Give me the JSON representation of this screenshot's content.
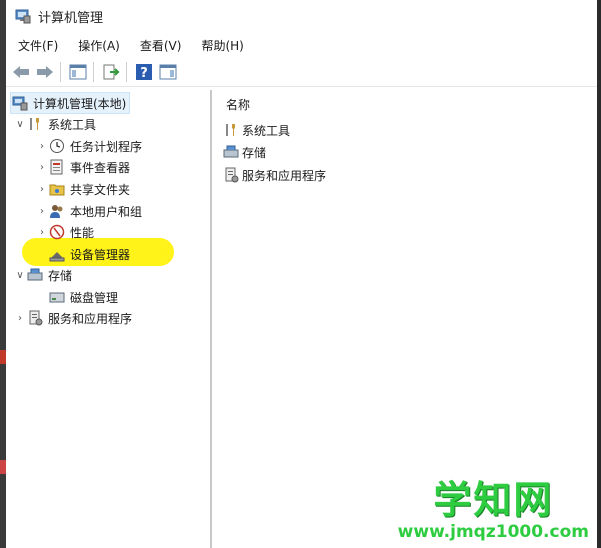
{
  "window": {
    "title": "计算机管理"
  },
  "menu": {
    "items": [
      "文件(F)",
      "操作(A)",
      "查看(V)",
      "帮助(H)"
    ]
  },
  "toolbar": {
    "icons": [
      "back-arrow-icon",
      "forward-arrow-icon",
      "console-tree-icon",
      "export-list-icon",
      "help-icon",
      "action-pane-icon"
    ]
  },
  "tree": {
    "root": "计算机管理(本地)",
    "items": [
      {
        "label": "系统工具",
        "expander": "∨"
      },
      {
        "label": "任务计划程序",
        "expander": "›"
      },
      {
        "label": "事件查看器",
        "expander": "›"
      },
      {
        "label": "共享文件夹",
        "expander": "›"
      },
      {
        "label": "本地用户和组",
        "expander": "›"
      },
      {
        "label": "性能",
        "expander": "›"
      },
      {
        "label": "设备管理器",
        "expander": ""
      },
      {
        "label": "存储",
        "expander": "∨"
      },
      {
        "label": "磁盘管理",
        "expander": ""
      },
      {
        "label": "服务和应用程序",
        "expander": "›"
      }
    ]
  },
  "content": {
    "column_header": "名称",
    "items": [
      "系统工具",
      "存储",
      "服务和应用程序"
    ]
  },
  "watermark": {
    "title": "学知网",
    "url": "www.jmqz1000.com"
  },
  "colors": {
    "highlight": "#fff200",
    "watermark": "#2ecc40",
    "selection": "#e5f1fb"
  }
}
